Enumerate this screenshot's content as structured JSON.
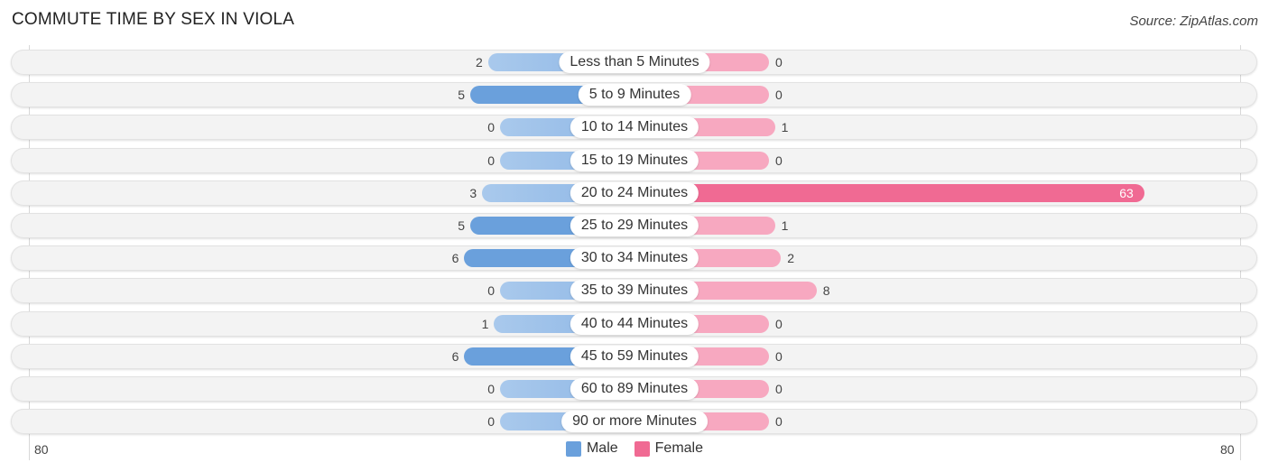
{
  "title": "COMMUTE TIME BY SEX IN VIOLA",
  "source": "Source: ZipAtlas.com",
  "colors": {
    "male": "#6aa0dc",
    "male_light": "#a9c9ec",
    "female": "#f06a93",
    "female_light": "#f7a8c0"
  },
  "chart_data": {
    "type": "bar",
    "orientation": "horizontal-diverging",
    "title": "COMMUTE TIME BY SEX IN VIOLA",
    "categories": [
      "Less than 5 Minutes",
      "5 to 9 Minutes",
      "10 to 14 Minutes",
      "15 to 19 Minutes",
      "20 to 24 Minutes",
      "25 to 29 Minutes",
      "30 to 34 Minutes",
      "35 to 39 Minutes",
      "40 to 44 Minutes",
      "45 to 59 Minutes",
      "60 to 89 Minutes",
      "90 or more Minutes"
    ],
    "series": [
      {
        "name": "Male",
        "values": [
          2,
          5,
          0,
          0,
          3,
          5,
          6,
          0,
          1,
          6,
          0,
          0
        ]
      },
      {
        "name": "Female",
        "values": [
          0,
          0,
          1,
          0,
          63,
          1,
          2,
          8,
          0,
          0,
          0,
          0
        ]
      }
    ],
    "xlim": [
      -80,
      80
    ],
    "axis_labels": {
      "left": "80",
      "right": "80"
    },
    "legend": [
      "Male",
      "Female"
    ],
    "legend_position": "bottom-center"
  }
}
